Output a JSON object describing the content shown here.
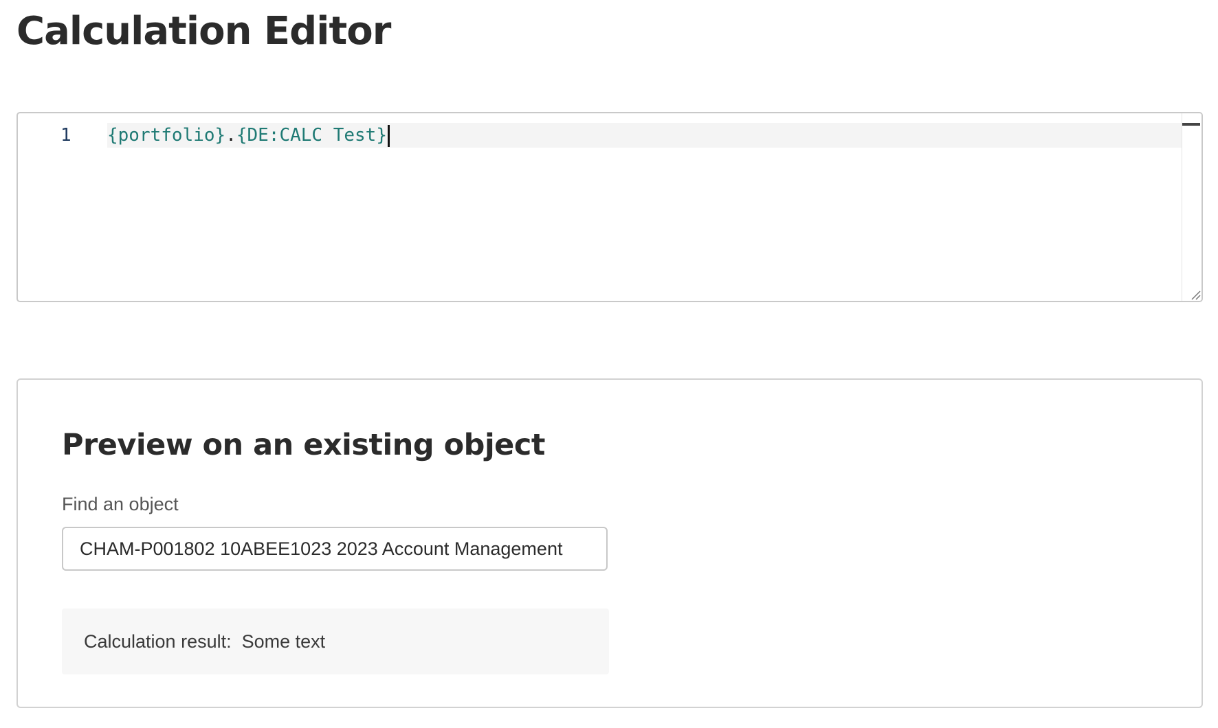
{
  "page": {
    "title": "Calculation Editor"
  },
  "editor": {
    "line_number": "1",
    "tokens": {
      "part1": "{portfolio}",
      "dot": ".",
      "part2": "{DE:CALC Test}"
    }
  },
  "preview": {
    "heading": "Preview on an existing object",
    "find_label": "Find an object",
    "find_value": "CHAM-P001802 10ABEE1023 2023 Account Management",
    "result_label": "Calculation result:",
    "result_value": "Some text"
  },
  "colors": {
    "code_token": "#1f7a74",
    "line_number": "#1f3a5f",
    "active_line": "#f4f4f4",
    "result_background": "#f7f7f7"
  }
}
